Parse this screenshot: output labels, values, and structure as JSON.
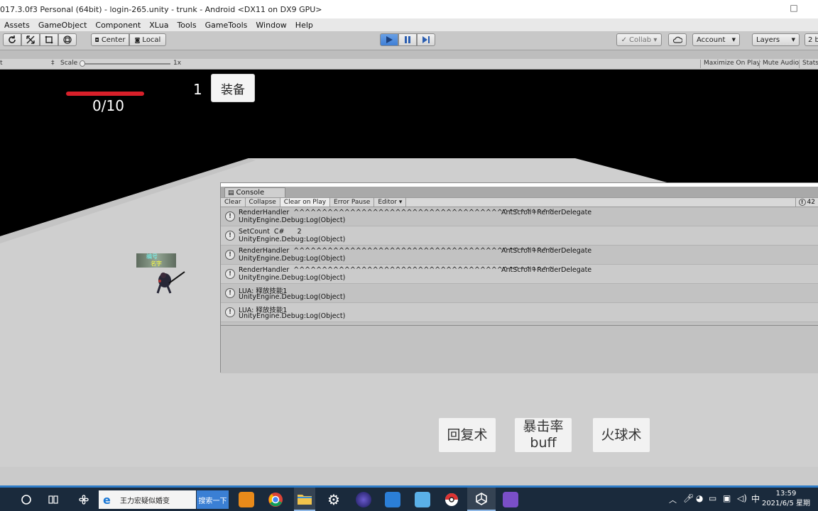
{
  "window": {
    "title": "017.3.0f3 Personal (64bit) - login-265.unity - trunk - Android <DX11 on DX9 GPU>",
    "maximize_glyph": "□"
  },
  "menu": [
    "Assets",
    "GameObject",
    "Component",
    "XLua",
    "Tools",
    "GameTools",
    "Window",
    "Help"
  ],
  "toolbar": {
    "pivot_center": "Center",
    "pivot_local": "Local",
    "collab": "Collab ▾",
    "account": "Account",
    "layers": "Layers",
    "layout": "2 b"
  },
  "game_toolbar": {
    "display_arrow": "‡",
    "scale_label": "Scale",
    "scale_value": "1x",
    "maximize_on_play": "Maximize On Play",
    "mute_audio": "Mute Audio",
    "stats": "Stats"
  },
  "game": {
    "hp_text": "0/10",
    "count": "1",
    "equip_button": "装备",
    "character_tag_top": "编号",
    "character_tag_bottom": "名字",
    "skills": [
      "回复术",
      "暴击率\nbuff",
      "火球术"
    ]
  },
  "console": {
    "tab_title": "Console",
    "buttons": [
      "Clear",
      "Collapse",
      "Clear on Play",
      "Error Pause",
      "Editor ▾"
    ],
    "active_button": "Clear on Play",
    "message_count": "42",
    "logs": [
      {
        "line1": "RenderHandler  ^^^^^^^^^^^^^^^^^^^^^^^^^^^^^^^^^^^^^^^^^^^^^^",
        "line1b": "AntScroll+RenderDelegate",
        "line2": "UnityEngine.Debug:Log(Object)"
      },
      {
        "line1": "SetCount  C#      2",
        "line1b": "",
        "line2": "UnityEngine.Debug:Log(Object)"
      },
      {
        "line1": "RenderHandler  ^^^^^^^^^^^^^^^^^^^^^^^^^^^^^^^^^^^^^^^^^^^^^^",
        "line1b": "AntScroll+RenderDelegate",
        "line2": "UnityEngine.Debug:Log(Object)"
      },
      {
        "line1": "RenderHandler  ^^^^^^^^^^^^^^^^^^^^^^^^^^^^^^^^^^^^^^^^^^^^^^",
        "line1b": "AntScroll+RenderDelegate",
        "line2": "UnityEngine.Debug:Log(Object)"
      },
      {
        "line1": "LUA: 释放技能1",
        "line1b": "",
        "line2": "UnityEngine.Debug:Log(Object)"
      },
      {
        "line1": "LUA: 释放技能1",
        "line1b": "",
        "line2": "UnityEngine.Debug:Log(Object)"
      }
    ]
  },
  "taskbar": {
    "search_text": "王力宏疑似婚变",
    "search_button": "搜索一下",
    "ime": "中",
    "time": "13:59",
    "date": "2021/6/5 星期"
  },
  "colors": {
    "hp_bar": "#d8202a",
    "play_active": "#3e7fd6",
    "taskbar_accent": "#2e7cc7"
  }
}
